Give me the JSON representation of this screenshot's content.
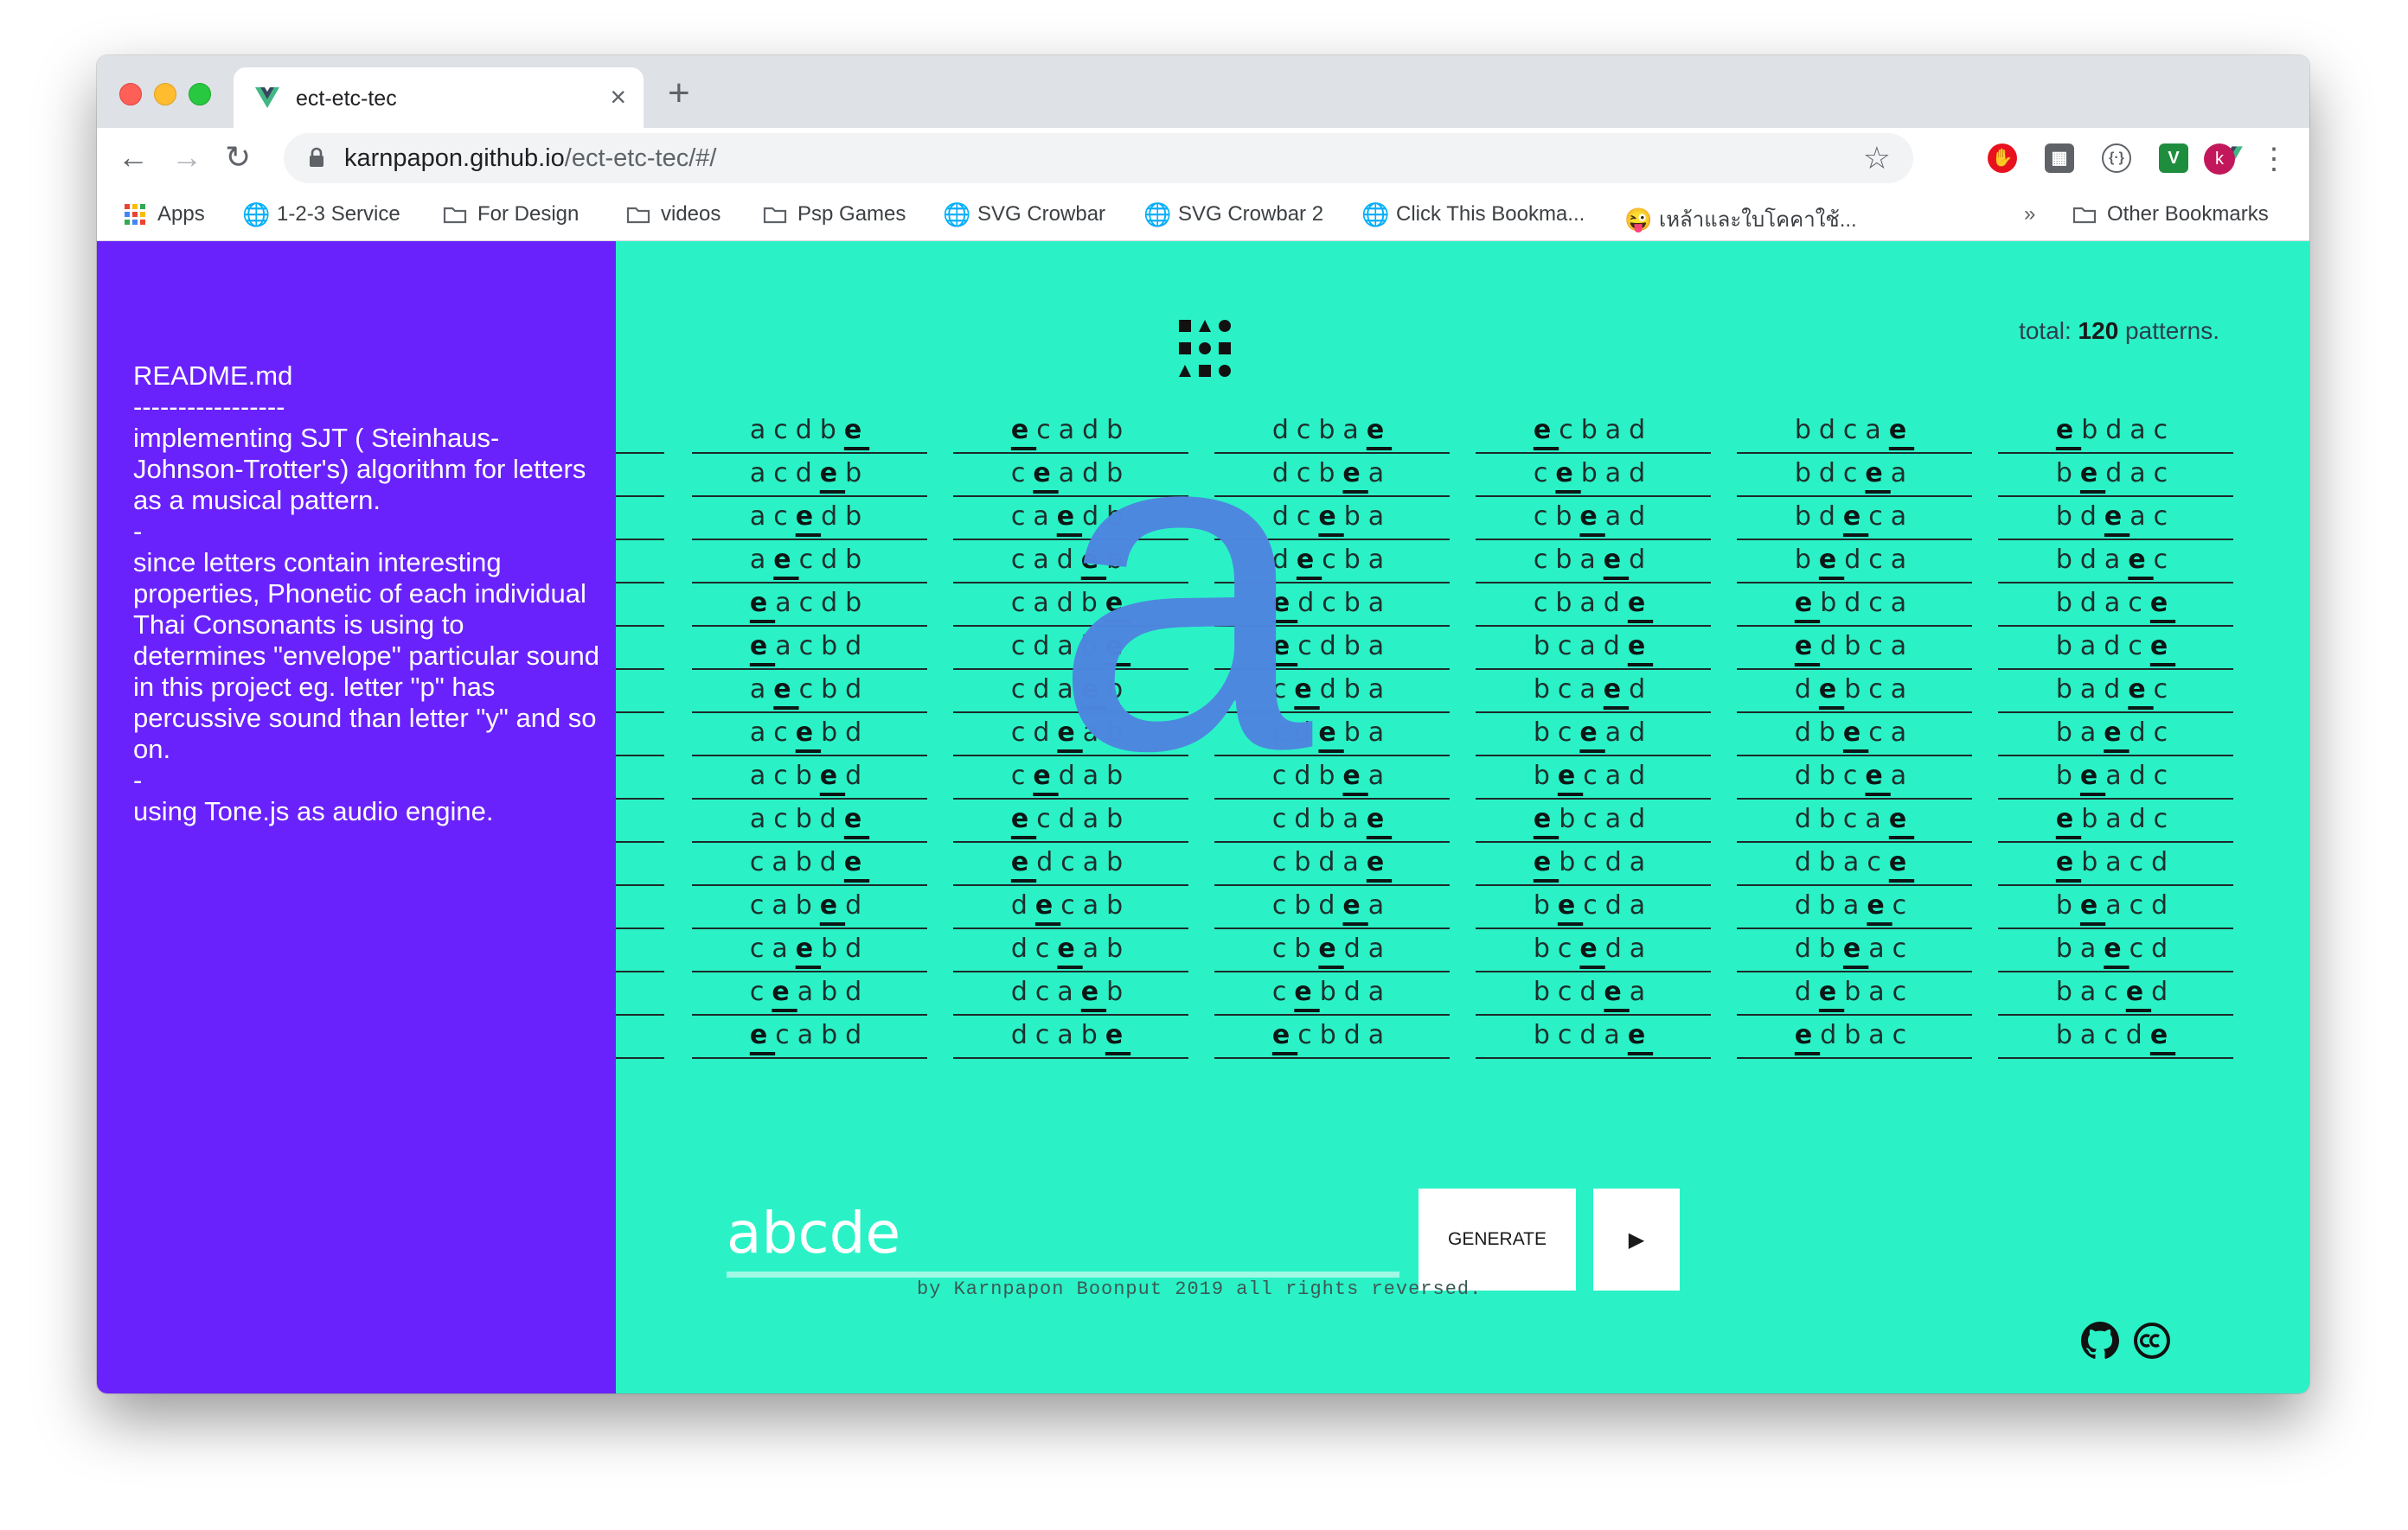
{
  "browser": {
    "tab_title": "ect-etc-tec",
    "url_host": "karnpapon.github.io",
    "url_path": "/ect-etc-tec/#/",
    "avatar_letter": "k",
    "bookmarks": [
      {
        "label": "Apps",
        "icon": "apps-grid-icon"
      },
      {
        "label": "1-2-3 Service",
        "icon": "globe-icon"
      },
      {
        "label": "For Design",
        "icon": "folder-icon"
      },
      {
        "label": "videos",
        "icon": "folder-icon"
      },
      {
        "label": "Psp Games",
        "icon": "folder-icon"
      },
      {
        "label": "SVG Crowbar",
        "icon": "globe-icon"
      },
      {
        "label": "SVG Crowbar 2",
        "icon": "globe-icon"
      },
      {
        "label": "Click This Bookma...",
        "icon": "globe-icon"
      },
      {
        "label": "เหล้าและใบโคคาใช้...",
        "icon": "emoji-icon"
      }
    ],
    "overflow_label": "»",
    "other_bookmarks": "Other Bookmarks"
  },
  "readme": {
    "title": "README.md",
    "divider": "-----------------",
    "para1": "implementing SJT ( Steinhaus-Johnson-Trotter's) algorithm for letters as a musical pattern.",
    "sep1": "-",
    "para2": "since letters contain interesting properties, Phonetic of each individual Thai Consonants is using to determines \"envelope\" particular sound in this project eg. letter \"p\" has percussive sound than letter \"y\" and so on.",
    "sep2": "-",
    "para3": "using Tone.js as audio engine."
  },
  "summary": {
    "prefix": "total: ",
    "count": "120",
    "suffix": " patterns."
  },
  "current_letter": "a",
  "patterns": [
    [
      "acdbe",
      "acdeb",
      "acedb",
      "aecdb",
      "eacdb",
      "eacbd",
      "aecbd",
      "acebd",
      "acbed",
      "acbde",
      "cabde",
      "cabed",
      "caebd",
      "ceabd",
      "ecabd"
    ],
    [
      "ecadb",
      "ceadb",
      "caedb",
      "cadeb",
      "cadbe",
      "cdabe",
      "cdaeb",
      "cdeab",
      "cedab",
      "ecdab",
      "edcab",
      "decab",
      "dceab",
      "dcaeb",
      "dcabe"
    ],
    [
      "dcbae",
      "dcbea",
      "dceba",
      "decba",
      "edcba",
      "ecdba",
      "cedba",
      "cdeba",
      "cdbea",
      "cdbae",
      "cbdae",
      "cbdea",
      "cbeda",
      "cebda",
      "ecbda"
    ],
    [
      "ecbad",
      "cebad",
      "cbead",
      "cbaed",
      "cbade",
      "bcade",
      "bcaed",
      "bcead",
      "becad",
      "ebcad",
      "ebcda",
      "becda",
      "bceda",
      "bcdea",
      "bcdae"
    ],
    [
      "bdcae",
      "bdcea",
      "bdeca",
      "bedca",
      "ebdca",
      "edbca",
      "debca",
      "dbeca",
      "dbcea",
      "dbcae",
      "dbace",
      "dbaec",
      "dbeac",
      "debac",
      "edbac"
    ],
    [
      "ebdac",
      "bedac",
      "bdeac",
      "bdaec",
      "bdace",
      "badce",
      "badec",
      "baedc",
      "beadc",
      "ebadc",
      "ebacd",
      "beacd",
      "baecd",
      "baced",
      "bacde"
    ]
  ],
  "input": {
    "value": "abcde"
  },
  "buttons": {
    "generate": "GENERATE",
    "play": "▶"
  },
  "footer": "by Karnpapon Boonput 2019 all rights reversed."
}
